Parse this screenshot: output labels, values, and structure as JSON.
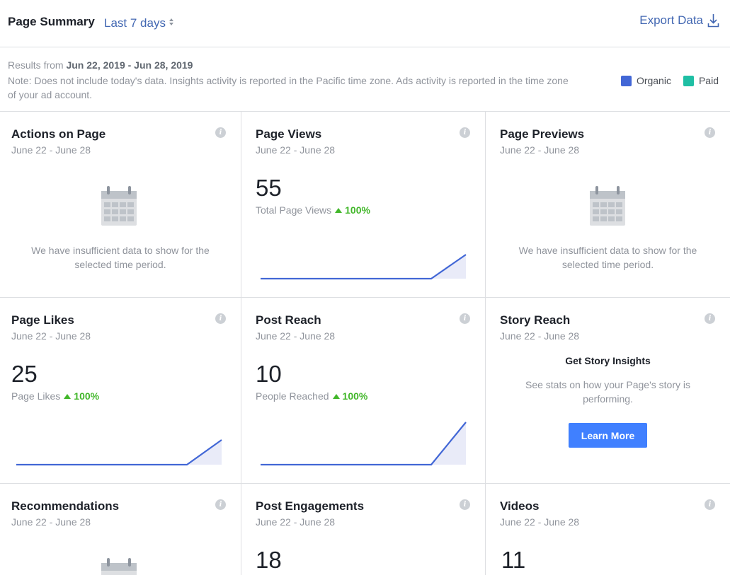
{
  "header": {
    "title": "Page Summary",
    "range_label": "Last 7 days",
    "export_label": "Export Data"
  },
  "notebar": {
    "results_prefix": "Results from",
    "results_range": "Jun 22, 2019 - Jun 28, 2019",
    "note": "Note: Does not include today's data. Insights activity is reported in the Pacific time zone. Ads activity is reported in the time zone of your ad account.",
    "legend": [
      {
        "label": "Organic",
        "color": "#4267d6"
      },
      {
        "label": "Paid",
        "color": "#1fbfa4"
      }
    ]
  },
  "cards": {
    "actions": {
      "title": "Actions on Page",
      "date": "June 22 - June 28",
      "empty": "We have insufficient data to show for the selected time period."
    },
    "views": {
      "title": "Page Views",
      "date": "June 22 - June 28",
      "value": "55",
      "sub": "Total Page Views",
      "delta": "100%"
    },
    "previews": {
      "title": "Page Previews",
      "date": "June 22 - June 28",
      "empty": "We have insufficient data to show for the selected time period."
    },
    "likes": {
      "title": "Page Likes",
      "date": "June 22 - June 28",
      "value": "25",
      "sub": "Page Likes",
      "delta": "100%"
    },
    "reach": {
      "title": "Post Reach",
      "date": "June 22 - June 28",
      "value": "10",
      "sub": "People Reached",
      "delta": "100%"
    },
    "story": {
      "title": "Story Reach",
      "date": "June 22 - June 28",
      "heading": "Get Story Insights",
      "desc": "See stats on how your Page's story is performing.",
      "button": "Learn More"
    },
    "recommendations": {
      "title": "Recommendations",
      "date": "June 22 - June 28"
    },
    "engagements": {
      "title": "Post Engagements",
      "date": "June 22 - June 28",
      "value": "18"
    },
    "videos": {
      "title": "Videos",
      "date": "June 22 - June 28",
      "value": "11"
    }
  },
  "info_glyph": "i"
}
